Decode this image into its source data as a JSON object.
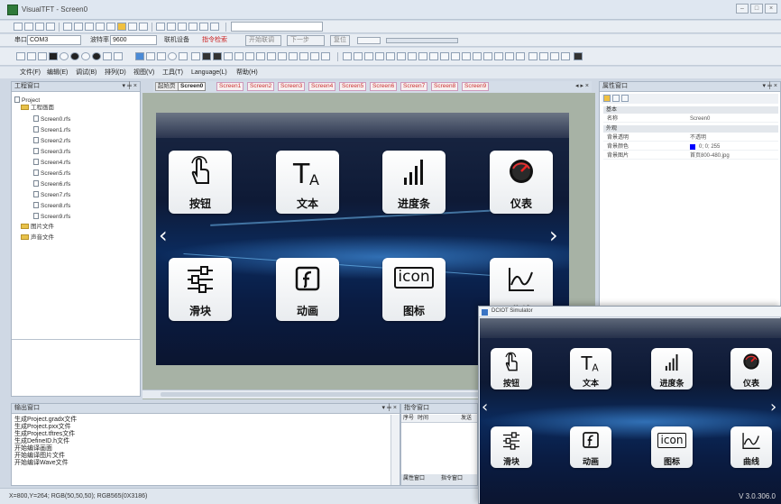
{
  "window": {
    "title": "VisualTFT - Screen0"
  },
  "toolbar2": {
    "port_label": "串口",
    "port_value": "COM3",
    "baud_label": "波特率",
    "baud_value": "9600",
    "connect_label": "联机设备",
    "cmd_label": "指令检索",
    "btn_a": "开始联调",
    "btn_b": "下一步",
    "btn_c": "复位"
  },
  "menu": [
    "文件(F)",
    "编辑(E)",
    "调试(B)",
    "排列(D)",
    "视图(V)",
    "工具(T)",
    "Language(L)",
    "帮助(H)"
  ],
  "project_panel": {
    "title": "工程窗口",
    "root": "Project",
    "folder": "工程画面",
    "screens": [
      "Screen0.rfs",
      "Screen1.rfs",
      "Screen2.rfs",
      "Screen3.rfs",
      "Screen4.rfs",
      "Screen5.rfs",
      "Screen6.rfs",
      "Screen7.rfs",
      "Screen8.rfs",
      "Screen9.rfs"
    ],
    "images_folder": "图片文件",
    "sounds_folder": "声音文件"
  },
  "tabs": [
    "起始页",
    "Screen0",
    "Screen1",
    "Screen2",
    "Screen3",
    "Screen4",
    "Screen5",
    "Screen6",
    "Screen7",
    "Screen8",
    "Screen9"
  ],
  "screen_tiles": [
    {
      "label": "按钮",
      "icon": "hand-pointer-icon"
    },
    {
      "label": "文本",
      "icon": "text-icon"
    },
    {
      "label": "进度条",
      "icon": "bar-chart-icon"
    },
    {
      "label": "仪表",
      "icon": "gauge-icon"
    },
    {
      "label": "滑块",
      "icon": "slider-icon"
    },
    {
      "label": "动画",
      "icon": "flash-icon"
    },
    {
      "label": "图标",
      "icon": "icon-box-icon"
    },
    {
      "label": "曲线",
      "icon": "curve-icon"
    }
  ],
  "icon_text": "icon",
  "props_panel": {
    "title": "属性窗口",
    "section1": "基本",
    "name_key": "名称",
    "name_val": "Screen0",
    "section2": "外观",
    "rows": [
      {
        "k": "背景透明",
        "v": "不透明"
      },
      {
        "k": "背景颜色",
        "v": "0; 0; 255"
      },
      {
        "k": "背景图片",
        "v": "首页800-480.jpg"
      }
    ],
    "bg_color": "#0000ff"
  },
  "output_panel": {
    "title": "输出窗口",
    "lines": [
      "生成Project.gradx文件",
      "生成Project.pxx文件",
      "生成Project.tftres文件",
      "生成DefineID.h文件",
      "开始编译画面",
      "开始编译图片文件",
      "开始编译Wave文件"
    ]
  },
  "cmd_panel": {
    "title": "指令窗口",
    "col1": "序号",
    "col2": "时间",
    "col3": "发送",
    "tab1": "属性窗口",
    "tab2": "指令窗口"
  },
  "simulator": {
    "title": "DCIOT Simulator",
    "version": "V 3.0.306.0"
  },
  "status": {
    "text": "X=800,Y=264; RGB(50,50,50); RGB565(0X3186)"
  }
}
